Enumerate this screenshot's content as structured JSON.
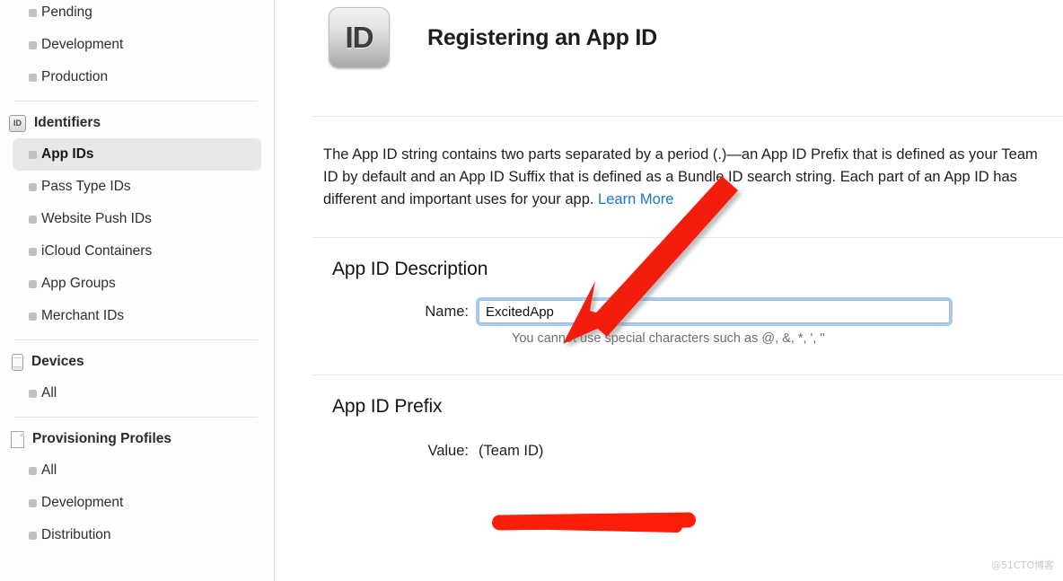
{
  "sidebar": {
    "groups": [
      {
        "name": "top-partial-group",
        "icon": null,
        "header": null,
        "items": [
          {
            "label": "Pending",
            "selected": false
          },
          {
            "label": "Development",
            "selected": false
          },
          {
            "label": "Production",
            "selected": false
          }
        ]
      },
      {
        "name": "identifiers",
        "icon": "id-badge-icon",
        "header": "Identifiers",
        "items": [
          {
            "label": "App IDs",
            "selected": true
          },
          {
            "label": "Pass Type IDs",
            "selected": false
          },
          {
            "label": "Website Push IDs",
            "selected": false
          },
          {
            "label": "iCloud Containers",
            "selected": false
          },
          {
            "label": "App Groups",
            "selected": false
          },
          {
            "label": "Merchant IDs",
            "selected": false
          }
        ]
      },
      {
        "name": "devices",
        "icon": "device-icon",
        "header": "Devices",
        "items": [
          {
            "label": "All",
            "selected": false
          }
        ]
      },
      {
        "name": "provisioning-profiles",
        "icon": "document-icon",
        "header": "Provisioning Profiles",
        "items": [
          {
            "label": "All",
            "selected": false
          },
          {
            "label": "Development",
            "selected": false
          },
          {
            "label": "Distribution",
            "selected": false
          }
        ]
      }
    ]
  },
  "main": {
    "badge_text": "ID",
    "title": "Registering an App ID",
    "intro": {
      "body": "The App ID string contains two parts separated by a period (.)—an App ID Prefix that is defined as your Team ID by default and an App ID Suffix that is defined as a Bundle ID search string. Each part of an App ID has different and important uses for your app. ",
      "link_label": "Learn More"
    },
    "description_section": {
      "title": "App ID Description",
      "name_label": "Name:",
      "name_value": "ExcitedApp",
      "name_placeholder": "",
      "hint": "You cannot use special characters such as @, &, *, ', \""
    },
    "prefix_section": {
      "title": "App ID Prefix",
      "value_label": "Value:",
      "value_text": "(Team ID)",
      "value_redacted": true
    }
  },
  "annotations": {
    "arrow_color": "#f41f0d",
    "redaction_color": "#fb1e0a"
  },
  "watermark": "@51CTO博客"
}
